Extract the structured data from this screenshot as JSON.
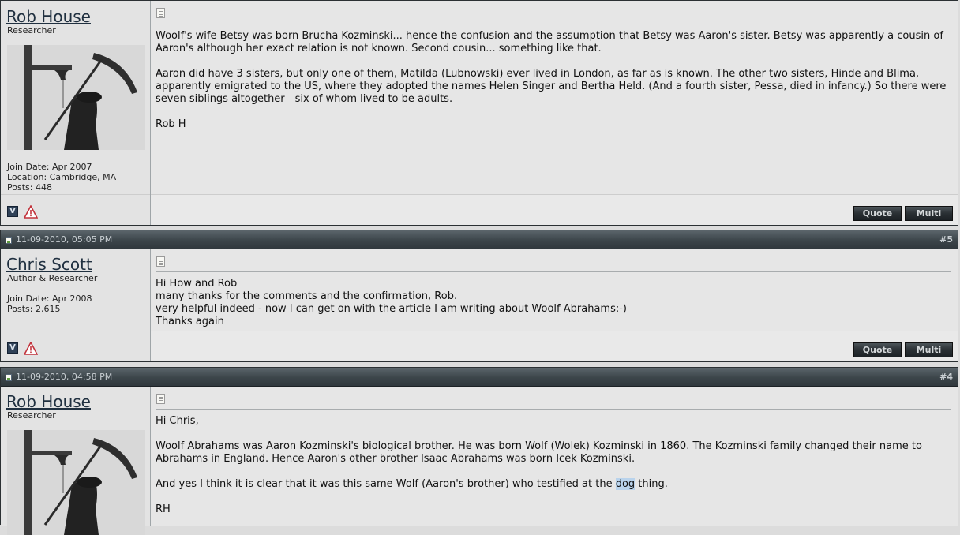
{
  "posts": [
    {
      "username": "Rob House",
      "user_title": "Researcher",
      "join_date": "Join Date: Apr 2007",
      "location": "Location: Cambridge, MA",
      "posts": "Posts: 448",
      "paragraphs": [
        "Woolf's wife Betsy was born Brucha Kozminski... hence the confusion and the assumption that Betsy was Aaron's sister. Betsy was apparently a cousin of Aaron's although her exact relation is not known. Second cousin... something like that.",
        "Aaron did have 3 sisters, but only one of them, Matilda (Lubnowski) ever lived in London, as far as is known. The other two sisters, Hinde and Blima, apparently emigrated to the US, where they adopted the names Helen Singer and Bertha Held. (And a fourth sister, Pessa, died in infancy.) So there were seven siblings altogether—six of whom lived to be adults.",
        "Rob H"
      ],
      "quote_label": "Quote",
      "multi_label": "Multi"
    },
    {
      "date": "11-09-2010, 05:05 PM",
      "number": "#5",
      "username": "Chris Scott",
      "user_title": "Author & Researcher",
      "join_date": "Join Date: Apr 2008",
      "posts": "Posts: 2,615",
      "lines": [
        "Hi How and Rob",
        "many thanks for the comments and the confirmation, Rob.",
        "very helpful indeed - now I can get on with the article I am writing about Woolf Abrahams:-)",
        "Thanks again"
      ],
      "quote_label": "Quote",
      "multi_label": "Multi"
    },
    {
      "date": "11-09-2010, 04:58 PM",
      "number": "#4",
      "username": "Rob House",
      "user_title": "Researcher",
      "p1": "Hi Chris,",
      "p2": "Woolf Abrahams was Aaron Kozminski's biological brother. He was born Wolf (Wolek) Kozminski in 1860. The Kozminski family changed their name to Abrahams in England. Hence Aaron's other brother Isaac Abrahams was born Icek Kozminski.",
      "p3_before": "And yes I think it is clear that it was this same Wolf (Aaron's brother) who testified at the ",
      "p3_highlight": "dog",
      "p3_after": " thing.",
      "p4": "RH"
    }
  ],
  "icons": {
    "vb_letter": "V",
    "colors": {
      "header_dark": "#30383d",
      "username": "#203040",
      "highlight": "#b9d3ec",
      "warn": "#c2333c"
    }
  }
}
